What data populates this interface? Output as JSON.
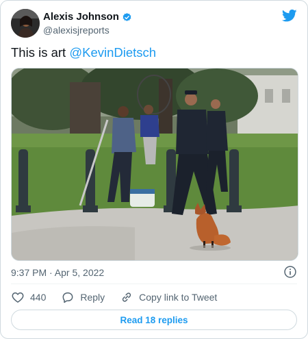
{
  "user": {
    "display_name": "Alexis Johnson",
    "handle": "@alexisjreports",
    "avatar_icon": "avatar-photo",
    "verified": true
  },
  "tweet": {
    "text": "This is art ",
    "mention": "@KevinDietsch",
    "photo_icon": "photo-police-chasing-fox-with-net"
  },
  "meta": {
    "timestamp": "9:37 PM · Apr 5, 2022"
  },
  "actions": {
    "like_count": "440",
    "reply_label": "Reply",
    "copy_label": "Copy link to Tweet"
  },
  "read_replies_label": "Read 18 replies",
  "colors": {
    "accent": "#1d9bf0",
    "text": "#0f1419",
    "secondary": "#536471",
    "border": "#cfd9de"
  }
}
